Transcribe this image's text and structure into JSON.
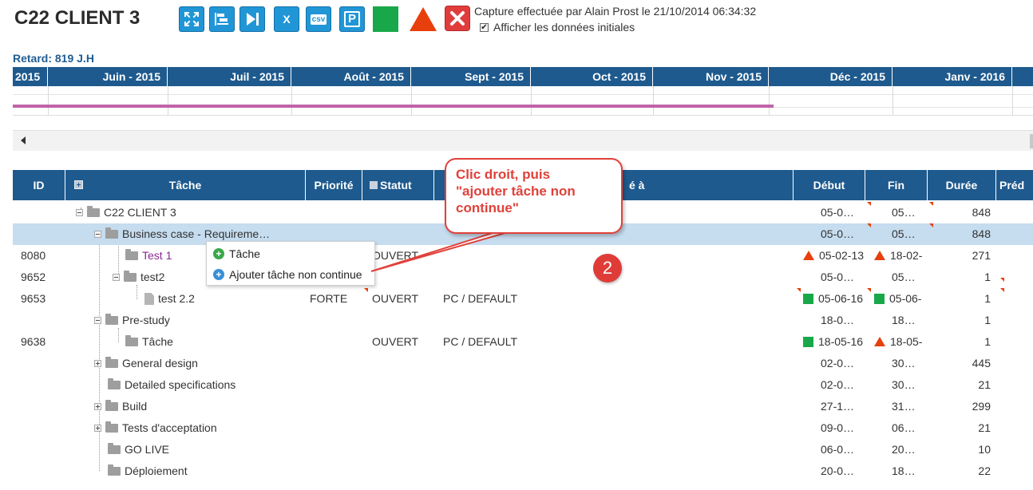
{
  "header": {
    "title": "C22 CLIENT 3",
    "capture_info": "Capture effectuée par Alain Prost le 21/10/2014 06:34:32",
    "checkbox_label": "Afficher les données initiales",
    "checkbox_checked": true,
    "retard": "Retard: 819 J.H"
  },
  "toolbar": {
    "buttons": [
      {
        "icon": "expand-icon"
      },
      {
        "icon": "gantt-icon"
      },
      {
        "icon": "skip-to-end-icon"
      },
      {
        "icon": "excel-export-icon",
        "label": "X"
      },
      {
        "icon": "csv-export-icon",
        "label": "csv"
      },
      {
        "icon": "parking-icon",
        "label": "P"
      },
      {
        "icon": "green-square-icon"
      },
      {
        "icon": "red-triangle-icon"
      },
      {
        "icon": "close-icon"
      }
    ]
  },
  "gantt": {
    "months": [
      "2015",
      "Juin - 2015",
      "Juil - 2015",
      "Août - 2015",
      "Sept - 2015",
      "Oct - 2015",
      "Nov - 2015",
      "Déc - 2015",
      "Janv - 2016"
    ],
    "bar_color": "#c064a8",
    "header_color": "#1e5a8e"
  },
  "grid": {
    "columns": {
      "id": "ID",
      "tache": "Tâche",
      "priorite": "Priorité",
      "statut": "Statut",
      "affecte": "é à",
      "debut": "Début",
      "fin": "Fin",
      "duree": "Durée",
      "pred": "Préd"
    },
    "rows": [
      {
        "id": "",
        "name": "C22 CLIENT 3",
        "prio": "",
        "stat": "",
        "aff": "",
        "deb": "05-0…",
        "fin": "05…",
        "dur": "848"
      },
      {
        "id": "",
        "name": "Business case - Requireme…",
        "prio": "",
        "stat": "",
        "aff": "",
        "deb": "05-0…",
        "fin": "05…",
        "dur": "848"
      },
      {
        "id": "8080",
        "name": "Test 1",
        "prio": "",
        "stat": "OUVERT",
        "aff": "",
        "deb": "05-02-13",
        "fin": "18-02-",
        "dur": "271"
      },
      {
        "id": "9652",
        "name": "test2",
        "prio": "",
        "stat": "",
        "aff": "",
        "deb": "05-0…",
        "fin": "05…",
        "dur": "1"
      },
      {
        "id": "9653",
        "name": "test 2.2",
        "prio": "FORTE",
        "stat": "OUVERT",
        "aff": "PC / DEFAULT",
        "deb": "05-06-16",
        "fin": "05-06-",
        "dur": "1"
      },
      {
        "id": "",
        "name": "Pre-study",
        "prio": "",
        "stat": "",
        "aff": "",
        "deb": "18-0…",
        "fin": "18…",
        "dur": "1"
      },
      {
        "id": "9638",
        "name": "Tâche",
        "prio": "",
        "stat": "OUVERT",
        "aff": "PC / DEFAULT",
        "deb": "18-05-16",
        "fin": "18-05-",
        "dur": "1"
      },
      {
        "id": "",
        "name": "General design",
        "prio": "",
        "stat": "",
        "aff": "",
        "deb": "02-0…",
        "fin": "30…",
        "dur": "445"
      },
      {
        "id": "",
        "name": "Detailed specifications",
        "prio": "",
        "stat": "",
        "aff": "",
        "deb": "02-0…",
        "fin": "30…",
        "dur": "21"
      },
      {
        "id": "",
        "name": "Build",
        "prio": "",
        "stat": "",
        "aff": "",
        "deb": "27-1…",
        "fin": "31…",
        "dur": "299"
      },
      {
        "id": "",
        "name": "Tests d'acceptation",
        "prio": "",
        "stat": "",
        "aff": "",
        "deb": "09-0…",
        "fin": "06…",
        "dur": "21"
      },
      {
        "id": "",
        "name": "GO LIVE",
        "prio": "",
        "stat": "",
        "aff": "",
        "deb": "06-0…",
        "fin": "20…",
        "dur": "10"
      },
      {
        "id": "",
        "name": "Déploiement",
        "prio": "",
        "stat": "",
        "aff": "",
        "deb": "20-0…",
        "fin": "18…",
        "dur": "22"
      }
    ]
  },
  "context_menu": {
    "items": [
      {
        "label": "Tâche",
        "icon": "add-green-icon"
      },
      {
        "label": "Ajouter tâche non continue",
        "icon": "add-blue-icon"
      }
    ]
  },
  "callout": {
    "text": "Clic droit, puis\n\"ajouter tâche non\ncontinue\"",
    "badge": "2"
  }
}
